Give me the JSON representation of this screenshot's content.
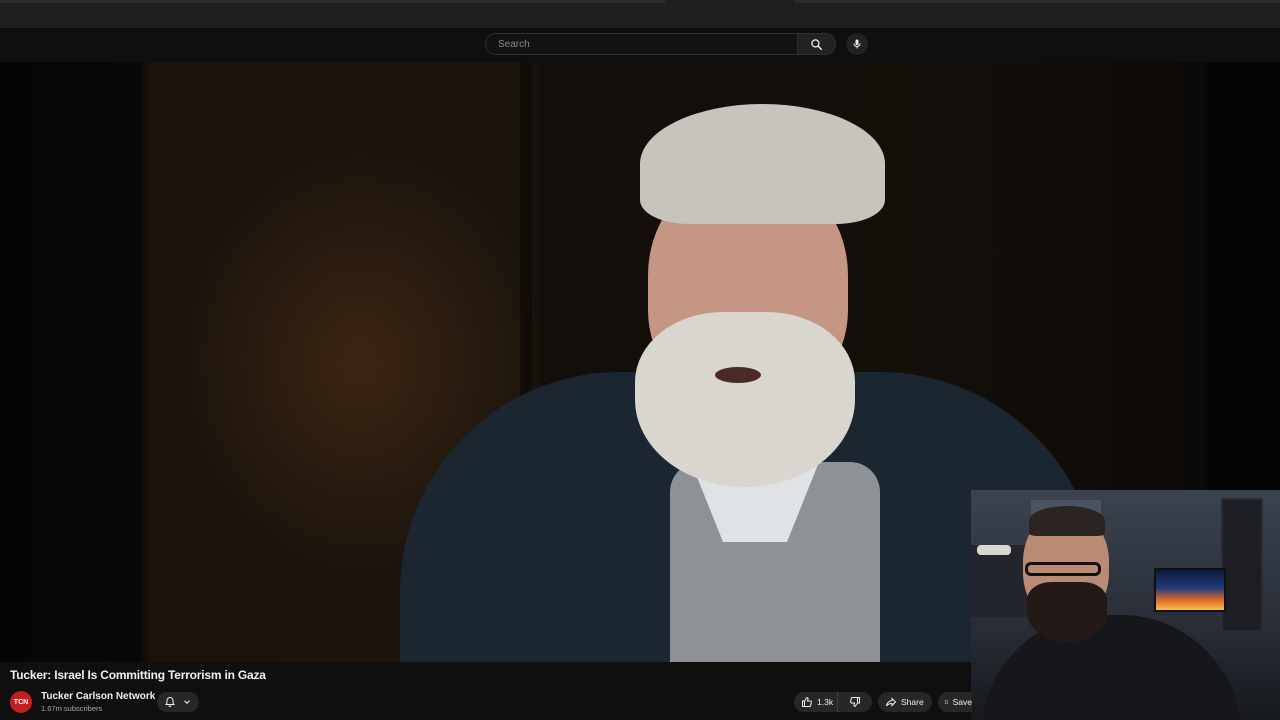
{
  "search": {
    "placeholder": "Search",
    "search_icon": "search-icon",
    "mic_icon": "microphone-icon"
  },
  "video": {
    "title": "Tucker: Israel Is Committing Terrorism in Gaza"
  },
  "channel": {
    "avatar_text": "TCN",
    "name": "Tucker Carlson Network",
    "subscribers": "1.67m subscribers",
    "brand_color": "#c41f1f"
  },
  "actions": {
    "like_count": "1.3k",
    "share_label": "Share",
    "save_label": "Save",
    "icons": [
      "bell-icon",
      "chevron-down-icon",
      "thumbs-up-icon",
      "thumbs-down-icon",
      "share-icon",
      "bookmark-icon"
    ]
  }
}
